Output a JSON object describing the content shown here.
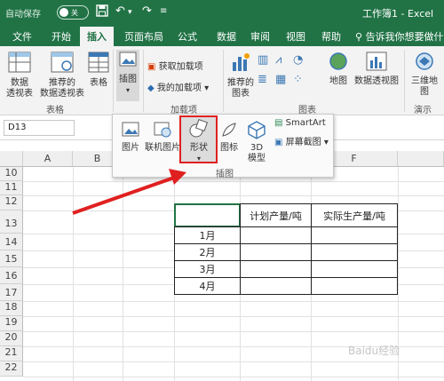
{
  "titlebar": {
    "autosave": "自动保存",
    "toggle": "关",
    "title": "工作簿1 - Excel"
  },
  "tabs": [
    "文件",
    "开始",
    "插入",
    "页面布局",
    "公式",
    "数据",
    "审阅",
    "视图",
    "帮助"
  ],
  "search": "告诉我你想要做什么",
  "ribbon": {
    "pivot": "数据\n透视表",
    "recommended_pivot": "推荐的\n数据透视表",
    "table": "表格",
    "group_tables": "表格",
    "illustrations": "插图",
    "get_addins": "获取加载项",
    "my_addins": "我的加载项",
    "group_addins": "加载项",
    "recommended_charts": "推荐的\n图表",
    "group_charts": "图表",
    "maps": "地图",
    "pivotchart": "数据透视图",
    "map3d": "三维地\n图",
    "group_tours": "演示"
  },
  "formula": {
    "namebox": "D13"
  },
  "panel": {
    "picture": "图片",
    "online_picture": "联机图片",
    "shapes": "形状",
    "icons": "图标",
    "model3d": "3D\n模型",
    "smartart": "SmartArt",
    "screenshot": "屏幕截图",
    "group": "插图"
  },
  "grid": {
    "columns": [
      "A",
      "B",
      "C",
      "D",
      "E",
      "F"
    ],
    "rows": [
      "10",
      "11",
      "12",
      "13",
      "14",
      "15",
      "16",
      "17",
      "18",
      "19",
      "20",
      "21",
      "22"
    ],
    "table": {
      "headers": [
        "",
        "计划产量/吨",
        "实际生产量/吨"
      ],
      "rows": [
        "1月",
        "2月",
        "3月",
        "4月"
      ]
    }
  },
  "watermark": "Baidu经验",
  "colors": {
    "excel_green": "#217346",
    "highlight_red": "#e02020"
  }
}
